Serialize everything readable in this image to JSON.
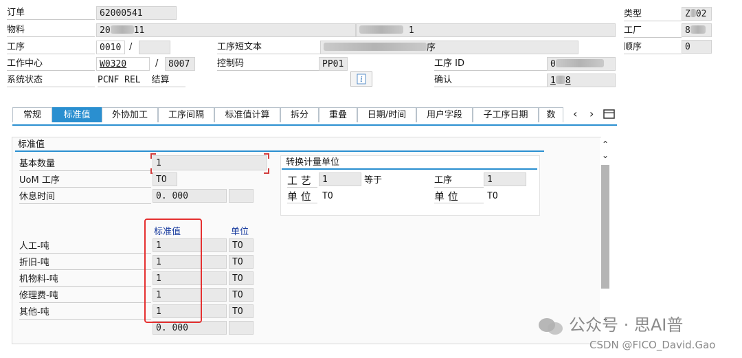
{
  "header": {
    "order": {
      "label": "订单",
      "value": "62000541"
    },
    "material": {
      "label": "物料",
      "value_a": "20",
      "value_b": "11",
      "desc_end": "1"
    },
    "operation": {
      "label": "工序",
      "value": "0010",
      "sep": "/"
    },
    "op_short_text": {
      "label": "工序短文本",
      "value_end": "序"
    },
    "work_center": {
      "label": "工作中心",
      "value": "W0320",
      "sep": "/",
      "plant": "8007"
    },
    "control_key": {
      "label": "控制码",
      "value": "PP01"
    },
    "op_id": {
      "label": "工序 ID",
      "value": "0"
    },
    "system_status": {
      "label": "系统状态",
      "value": "PCNF  REL",
      "value2": "结算"
    },
    "confirmation": {
      "label": "确认",
      "value_a": "1",
      "value_b": "8"
    },
    "type": {
      "label": "类型",
      "value": "Z",
      "value_end": "02"
    },
    "plant": {
      "label": "工厂",
      "value": "8"
    },
    "sequence": {
      "label": "顺序",
      "value": "0"
    },
    "info_icon": "info-icon"
  },
  "tabs": [
    {
      "label": "常规",
      "active": false
    },
    {
      "label": "标准值",
      "active": true
    },
    {
      "label": "外协加工",
      "active": false
    },
    {
      "label": "工序间隔",
      "active": false
    },
    {
      "label": "标准值计算",
      "active": false
    },
    {
      "label": "拆分",
      "active": false
    },
    {
      "label": "重叠",
      "active": false
    },
    {
      "label": "日期/时间",
      "active": false
    },
    {
      "label": "用户字段",
      "active": false
    },
    {
      "label": "子工序日期",
      "active": false
    },
    {
      "label": "数",
      "active": false
    }
  ],
  "tab_nav": {
    "left": "‹",
    "right": "›",
    "menu": "menu-icon"
  },
  "std": {
    "section_title": "标准值",
    "base_qty": {
      "label": "基本数量",
      "value": "1"
    },
    "uom": {
      "label": "UoM 工序",
      "value": "TO"
    },
    "break_time": {
      "label": "休息时间",
      "value": "0. 000"
    },
    "col_value": "标准值",
    "col_unit": "单位",
    "rows": [
      {
        "label": "人工-吨",
        "value": "1",
        "unit": "TO"
      },
      {
        "label": "折旧-吨",
        "value": "1",
        "unit": "TO"
      },
      {
        "label": "机物料-吨",
        "value": "1",
        "unit": "TO"
      },
      {
        "label": "修理费-吨",
        "value": "1",
        "unit": "TO"
      },
      {
        "label": "其他-吨",
        "value": "1",
        "unit": "TO"
      }
    ],
    "last_value": "0. 000"
  },
  "conv": {
    "title": "转换计量单位",
    "proc_label": "工 艺",
    "proc_value": "1",
    "equals": "等于",
    "op_label": "工序",
    "op_value": "1",
    "unit_label": "单 位",
    "unit_value": "TO",
    "unit_label2": "单 位",
    "unit_value2": "TO"
  },
  "watermark": {
    "line1": "公众号 · 思AI普",
    "line2": "CSDN @FICO_David.Gao"
  },
  "colors": {
    "accent": "#2a8fd0",
    "highlight": "#e53030"
  }
}
